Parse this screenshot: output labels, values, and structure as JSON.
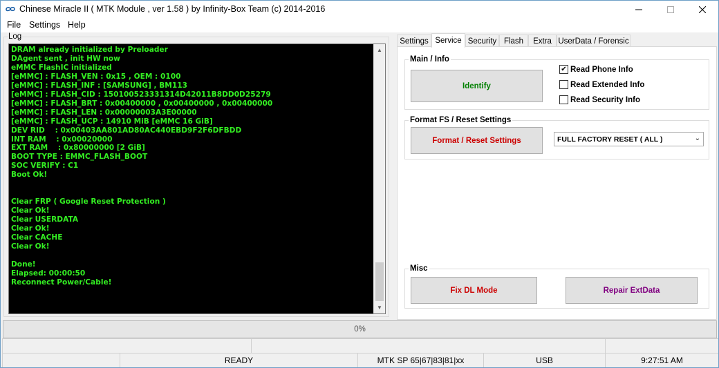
{
  "window": {
    "title": "Chinese Miracle II ( MTK Module , ver 1.58 ) by Infinity-Box Team (c) 2014-2016",
    "app_icon": "infinity-logo-icon"
  },
  "menu": [
    "File",
    "Settings",
    "Help"
  ],
  "log": {
    "label": "Log",
    "lines": [
      "DRAM already initialized by Preloader",
      "DAgent sent , init HW now",
      "eMMC FlashIC initialized",
      "[eMMC] : FLASH_VEN : 0x15 , OEM : 0100",
      "[eMMC] : FLASH_INF : [SAMSUNG] , BM113",
      "[eMMC] : FLASH_CID : 150100523331314D42011B8DD0D25279",
      "[eMMC] : FLASH_BRT : 0x00400000 , 0x00400000 , 0x00400000",
      "[eMMC] : FLASH_LEN : 0x00000003A3E00000",
      "[eMMC] : FLASH_UCP : 14910 MiB [eMMC 16 GiB]",
      "DEV RID    : 0x00403AA801AD80AC440EBD9F2F6DFBDD",
      "INT RAM    : 0x00020000",
      "EXT RAM    : 0x80000000 [2 GiB]",
      "BOOT TYPE : EMMC_FLASH_BOOT",
      "SOC VERIFY : C1",
      "Boot Ok!",
      "",
      "",
      "Clear FRP ( Google Reset Protection )",
      "Clear Ok!",
      "Clear USERDATA",
      "Clear Ok!",
      "Clear CACHE",
      "Clear Ok!",
      "",
      "Done!",
      "Elapsed: 00:00:50",
      "Reconnect Power/Cable!"
    ]
  },
  "tabs": [
    "Settings",
    "Service",
    "Security",
    "Flash",
    "Extra",
    "UserData / Forensic"
  ],
  "active_tab": "Service",
  "service": {
    "main_info": {
      "title": "Main / Info",
      "identify_label": "Identify",
      "checkboxes": [
        {
          "label": "Read Phone Info",
          "checked": true
        },
        {
          "label": "Read Extended Info",
          "checked": false
        },
        {
          "label": "Read Security Info",
          "checked": false
        }
      ]
    },
    "format": {
      "title": "Format FS / Reset Settings",
      "button_label": "Format / Reset Settings",
      "select_value": "FULL FACTORY RESET ( ALL )"
    },
    "misc": {
      "title": "Misc",
      "fix_dl_label": "Fix DL Mode",
      "repair_label": "Repair ExtData"
    }
  },
  "progress": {
    "value_percent": 0,
    "text": "0%"
  },
  "status": {
    "state": "READY",
    "chip": "MTK SP 65|67|83|81|xx",
    "port": "USB",
    "time": "9:27:51 AM"
  },
  "colors": {
    "log_text": "#33ee22",
    "log_bg": "#000000",
    "identify_text": "#008000",
    "format_text": "#cc0000",
    "fix_dl_text": "#cc0000",
    "repair_text": "#800080",
    "progress_fill": "#06b025"
  }
}
